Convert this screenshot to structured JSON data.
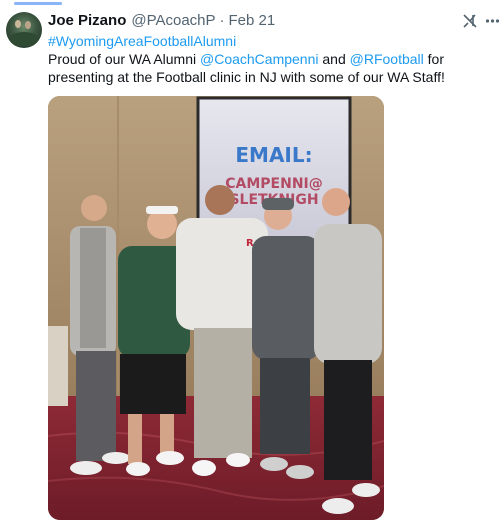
{
  "tweet": {
    "author_name": "Joe Pizano",
    "author_handle": "@PAcoachP",
    "separator": "·",
    "date": "Feb 21",
    "more_icon": "more-icon",
    "grok_icon": "grok-icon",
    "hashtag": "#WyomingAreaFootballAlumni",
    "text_part1": "Proud of our WA Alumni ",
    "mention1": "@CoachCampenni",
    "text_part2": " and ",
    "mention2": "@RFootball",
    "text_part3": " for presenting at the Football clinic in NJ with some of our WA Staff!"
  },
  "photo": {
    "screen_line1": "EMAIL:",
    "screen_line2": "CAMPENNI@",
    "screen_line3": "SLETKNIGH",
    "jersey_letter": "R"
  },
  "colors": {
    "link": "#1d9bf0",
    "text": "#0f1419",
    "muted": "#536471"
  }
}
